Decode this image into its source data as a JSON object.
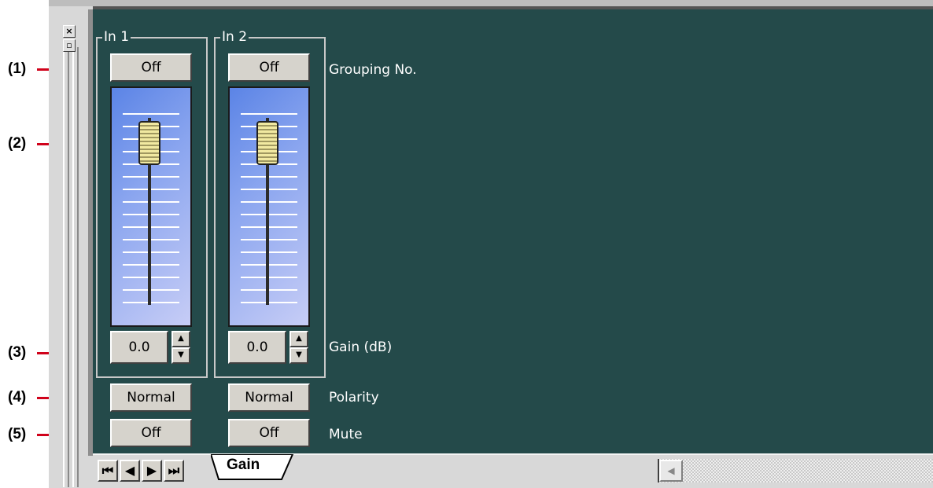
{
  "callouts": [
    "(1)",
    "(2)",
    "(3)",
    "(4)",
    "(5)"
  ],
  "window_controls": {
    "close_glyph": "×",
    "restore_glyph": "▫"
  },
  "channels": [
    {
      "title": "In 1",
      "grouping": "Off",
      "gain": "0.0",
      "polarity": "Normal",
      "mute": "Off"
    },
    {
      "title": "In 2",
      "grouping": "Off",
      "gain": "0.0",
      "polarity": "Normal",
      "mute": "Off"
    }
  ],
  "row_labels": {
    "grouping": "Grouping No.",
    "gain": "Gain (dB)",
    "polarity": "Polarity",
    "mute": "Mute"
  },
  "spin": {
    "up": "▲",
    "down": "▼"
  },
  "tabbar": {
    "nav": [
      "⏮",
      "◀",
      "▶",
      "⏭"
    ],
    "active_tab": "Gain",
    "scroll_left": "◀"
  },
  "colors": {
    "panel": "#244a4a",
    "callout_line": "#d0021b",
    "fader_knob": "#f1e9a1"
  }
}
